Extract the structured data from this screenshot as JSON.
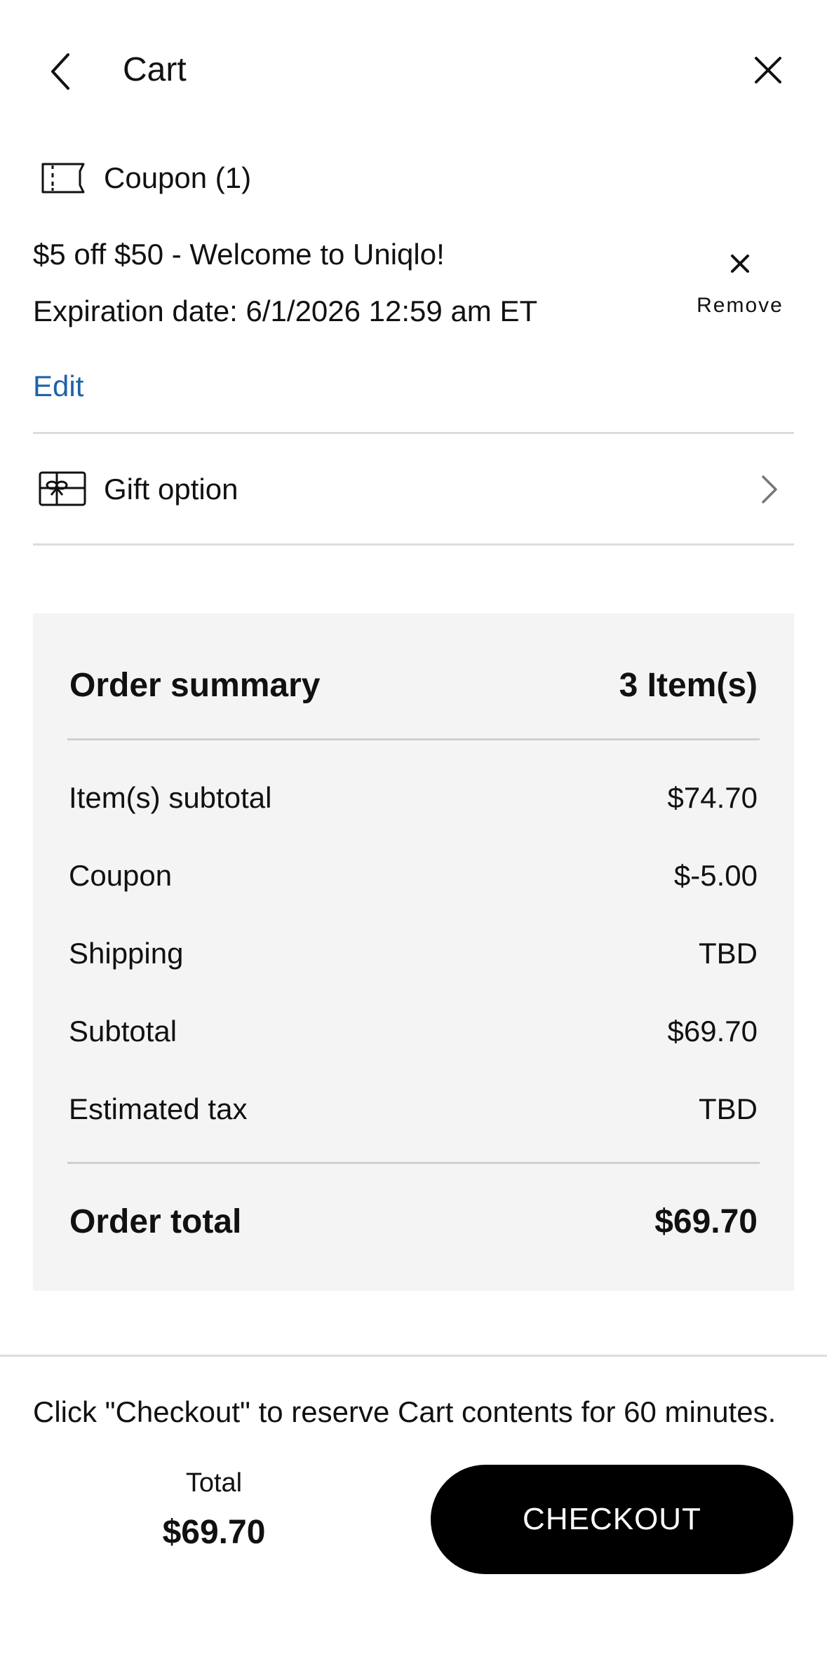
{
  "header": {
    "title": "Cart",
    "back_icon": "chevron-left-icon",
    "close_icon": "close-icon"
  },
  "coupon": {
    "heading": "Coupon (1)",
    "description": "$5 off $50 - Welcome to Uniqlo!",
    "expiration": "Expiration date: 6/1/2026 12:59 am ET",
    "remove_label": "Remove",
    "edit_label": "Edit",
    "icon": "ticket-icon",
    "link_color": "#1f63a8"
  },
  "gift": {
    "label": "Gift option",
    "icon": "gift-card-icon"
  },
  "summary": {
    "title": "Order summary",
    "count": "3 Item(s)",
    "rows": [
      {
        "label": "Item(s) subtotal",
        "value": "$74.70"
      },
      {
        "label": "Coupon",
        "value": "$-5.00"
      },
      {
        "label": "Shipping",
        "value": "TBD"
      },
      {
        "label": "Subtotal",
        "value": "$69.70"
      },
      {
        "label": "Estimated tax",
        "value": "TBD"
      }
    ],
    "total_label": "Order total",
    "total_value": "$69.70",
    "background": "#f4f4f4"
  },
  "footer": {
    "notice": "Click \"Checkout\" to reserve Cart contents for 60 minutes.",
    "total_label": "Total",
    "total_value": "$69.70",
    "checkout_label": "CHECKOUT",
    "checkout_color": "#000000"
  }
}
